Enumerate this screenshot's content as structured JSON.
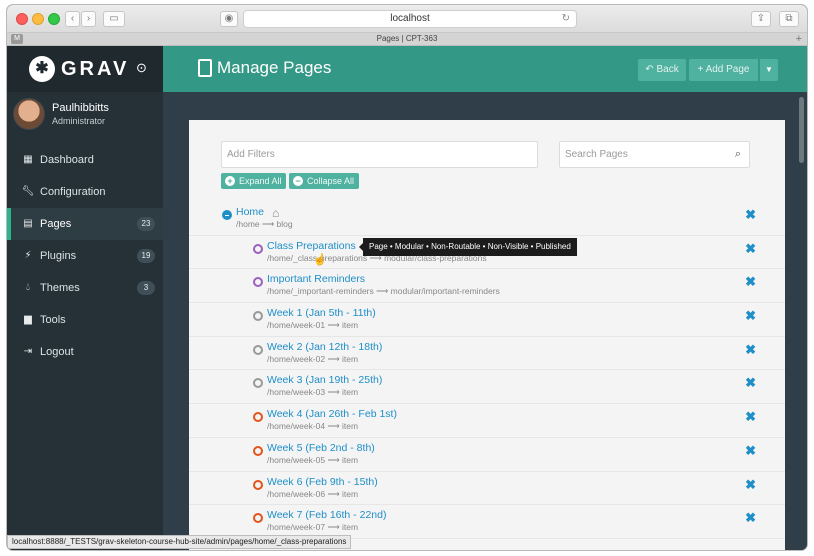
{
  "browser": {
    "url": "localhost",
    "tab_title": "Pages | CPT-363",
    "tab_badge": "M",
    "status_url": "localhost:8888/_TESTS/grav-skeleton-course-hub-site/admin/pages/home/_class-preparations"
  },
  "brand": {
    "logo_text": "GRAV"
  },
  "user": {
    "name": "Paulhibbitts",
    "role": "Administrator"
  },
  "sidebar": {
    "items": [
      {
        "label": "Dashboard",
        "icon": "dashboard-icon",
        "badge": ""
      },
      {
        "label": "Configuration",
        "icon": "wrench-icon",
        "badge": ""
      },
      {
        "label": "Pages",
        "icon": "file-icon",
        "badge": "23",
        "active": true
      },
      {
        "label": "Plugins",
        "icon": "plug-icon",
        "badge": "19"
      },
      {
        "label": "Themes",
        "icon": "tint-icon",
        "badge": "3"
      },
      {
        "label": "Tools",
        "icon": "briefcase-icon",
        "badge": ""
      },
      {
        "label": "Logout",
        "icon": "sign-out-icon",
        "badge": ""
      }
    ]
  },
  "header": {
    "title": "Manage Pages",
    "back_label": "Back",
    "add_label": "Add Page"
  },
  "filters": {
    "filter_placeholder": "Add Filters",
    "search_placeholder": "Search Pages",
    "expand_label": "Expand All",
    "collapse_label": "Collapse All"
  },
  "tooltip": "Page • Modular • Non-Routable • Non-Visible • Published",
  "pages": [
    {
      "title": "Home",
      "route": "/home ⟶ blog",
      "status": "root"
    },
    {
      "title": "Class Preparations",
      "route": "/home/_class-preparations ⟶ modular/class-preparations",
      "status": "purple"
    },
    {
      "title": "Important Reminders",
      "route": "/home/_important-reminders ⟶ modular/important-reminders",
      "status": "purple"
    },
    {
      "title": "Week 1 (Jan 5th - 11th)",
      "route": "/home/week-01 ⟶ item",
      "status": "grey"
    },
    {
      "title": "Week 2 (Jan 12th - 18th)",
      "route": "/home/week-02 ⟶ item",
      "status": "grey"
    },
    {
      "title": "Week 3 (Jan 19th - 25th)",
      "route": "/home/week-03 ⟶ item",
      "status": "grey"
    },
    {
      "title": "Week 4 (Jan 26th - Feb 1st)",
      "route": "/home/week-04 ⟶ item",
      "status": "orange"
    },
    {
      "title": "Week 5 (Feb 2nd - 8th)",
      "route": "/home/week-05 ⟶ item",
      "status": "orange"
    },
    {
      "title": "Week 6 (Feb 9th - 15th)",
      "route": "/home/week-06 ⟶ item",
      "status": "orange"
    },
    {
      "title": "Week 7 (Feb 16th - 22nd)",
      "route": "/home/week-07 ⟶ item",
      "status": "orange"
    }
  ],
  "colors": {
    "accent": "#349886",
    "link": "#1e8fc8",
    "sidebar": "#253137"
  }
}
